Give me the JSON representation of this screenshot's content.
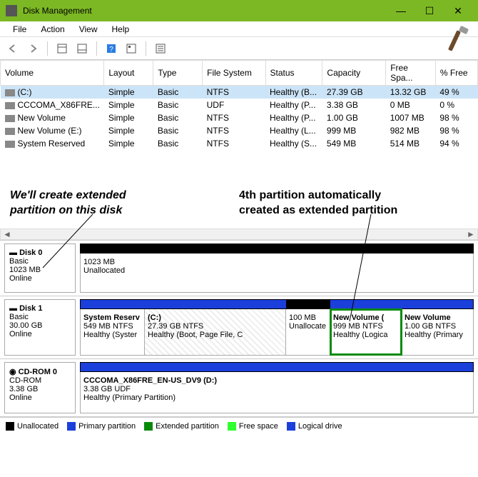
{
  "window": {
    "title": "Disk Management",
    "minimize": "—",
    "maximize": "☐",
    "close": "✕"
  },
  "menu": {
    "file": "File",
    "action": "Action",
    "view": "View",
    "help": "Help"
  },
  "table": {
    "headers": {
      "volume": "Volume",
      "layout": "Layout",
      "type": "Type",
      "fs": "File System",
      "status": "Status",
      "capacity": "Capacity",
      "free": "Free Spa...",
      "pct": "% Free"
    },
    "rows": [
      {
        "volume": "(C:)",
        "layout": "Simple",
        "type": "Basic",
        "fs": "NTFS",
        "status": "Healthy (B...",
        "capacity": "27.39 GB",
        "free": "13.32 GB",
        "pct": "49 %",
        "selected": true
      },
      {
        "volume": "CCCOMA_X86FRE...",
        "layout": "Simple",
        "type": "Basic",
        "fs": "UDF",
        "status": "Healthy (P...",
        "capacity": "3.38 GB",
        "free": "0 MB",
        "pct": "0 %"
      },
      {
        "volume": "New Volume",
        "layout": "Simple",
        "type": "Basic",
        "fs": "NTFS",
        "status": "Healthy (P...",
        "capacity": "1.00 GB",
        "free": "1007 MB",
        "pct": "98 %"
      },
      {
        "volume": "New Volume (E:)",
        "layout": "Simple",
        "type": "Basic",
        "fs": "NTFS",
        "status": "Healthy (L...",
        "capacity": "999 MB",
        "free": "982 MB",
        "pct": "98 %"
      },
      {
        "volume": "System Reserved",
        "layout": "Simple",
        "type": "Basic",
        "fs": "NTFS",
        "status": "Healthy (S...",
        "capacity": "549 MB",
        "free": "514 MB",
        "pct": "94 %"
      }
    ]
  },
  "annot": {
    "left": "We'll create extended\npartition on this disk",
    "right": "4th partition automatically\ncreated as extended partition"
  },
  "disks": {
    "d0": {
      "name": "Disk 0",
      "type": "Basic",
      "size": "1023 MB",
      "status": "Online",
      "p0_size": "1023 MB",
      "p0_status": "Unallocated"
    },
    "d1": {
      "name": "Disk 1",
      "type": "Basic",
      "size": "30.00 GB",
      "status": "Online",
      "p0_name": "System Reserv",
      "p0_size": "549 MB NTFS",
      "p0_status": "Healthy (Syster",
      "p1_name": "(C:)",
      "p1_size": "27.39 GB NTFS",
      "p1_status": "Healthy (Boot, Page File, C",
      "p2_size": "100 MB",
      "p2_status": "Unallocate",
      "p3_name": "New Volume  (",
      "p3_size": "999 MB NTFS",
      "p3_status": "Healthy (Logica",
      "p4_name": "New Volume",
      "p4_size": "1.00 GB NTFS",
      "p4_status": "Healthy (Primary"
    },
    "cd": {
      "name": "CD-ROM 0",
      "type": "CD-ROM",
      "size": "3.38 GB",
      "status": "Online",
      "p0_name": "CCCOMA_X86FRE_EN-US_DV9  (D:)",
      "p0_size": "3.38 GB UDF",
      "p0_status": "Healthy (Primary Partition)"
    }
  },
  "legend": {
    "unalloc": "Unallocated",
    "primary": "Primary partition",
    "extended": "Extended partition",
    "free": "Free space",
    "logical": "Logical drive"
  },
  "colors": {
    "unalloc": "#000000",
    "primary": "#1b3fdb",
    "extended": "#0a8a0a",
    "free": "#30ff30",
    "logical": "#1b3fdb"
  }
}
